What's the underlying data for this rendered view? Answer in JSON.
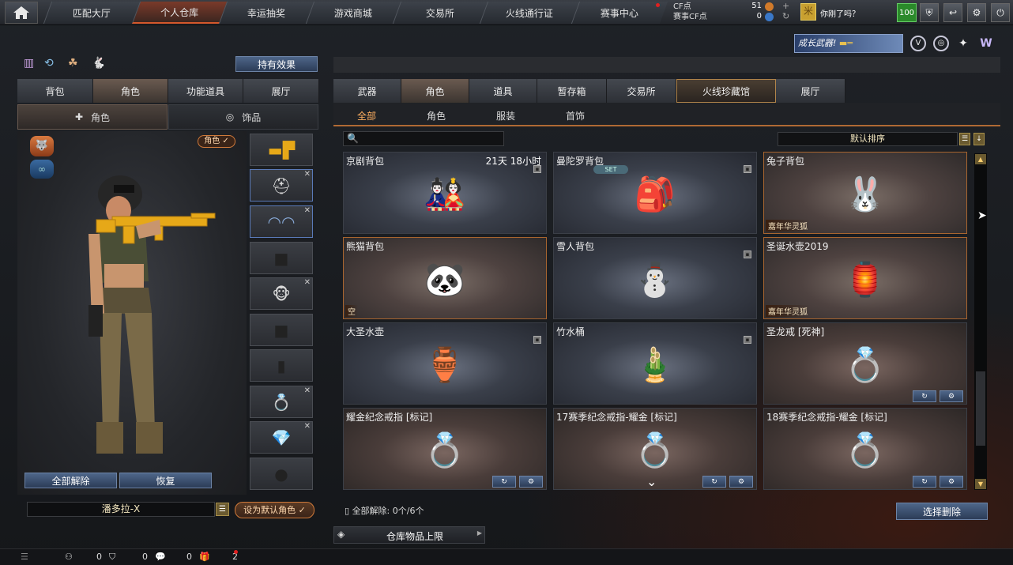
{
  "nav": {
    "tabs": [
      "匹配大厅",
      "个人仓库",
      "幸运抽奖",
      "游戏商城",
      "交易所",
      "火线通行证",
      "赛事中心"
    ],
    "active_index": 1,
    "cf_label": "CF点",
    "match_cf_label": "赛事CF点",
    "cf_value": "51",
    "match_cf_value": "0",
    "guess_text": "你刚了吗？",
    "level_badge": "100"
  },
  "banner": {
    "text": "成长武器!"
  },
  "left": {
    "effect_button": "持有效果",
    "tabs": [
      "背包",
      "角色",
      "功能道具",
      "展厅"
    ],
    "active_tab": 1,
    "subtabs": [
      "角色",
      "饰品"
    ],
    "role_badge": "角色 ✓",
    "unequip_all": "全部解除",
    "restore": "恢复",
    "character_name": "潘多拉-X",
    "set_default": "设为默认角色 ✓"
  },
  "right": {
    "tabs": [
      "武器",
      "角色",
      "道具",
      "暂存箱",
      "交易所",
      "火线珍藏馆",
      "展厅"
    ],
    "active_tab": 1,
    "filters": [
      "全部",
      "角色",
      "服装",
      "首饰"
    ],
    "active_filter": 0,
    "search_placeholder": "",
    "sort_label": "默认排序",
    "items": [
      {
        "name": "京剧背包",
        "time": "21天 18小时",
        "icon": "🎎",
        "lock": true,
        "style": "normal"
      },
      {
        "name": "曼陀罗背包",
        "set": "SET",
        "icon": "🎒",
        "lock": true,
        "style": "normal"
      },
      {
        "name": "兔子背包",
        "tag": "嘉年华灵狐",
        "icon": "🐰",
        "lock": false,
        "style": "gold"
      },
      {
        "name": "熊猫背包",
        "tag": "空",
        "icon": "🐼",
        "lock": false,
        "style": "gold"
      },
      {
        "name": "雪人背包",
        "icon": "⛄",
        "lock": true,
        "style": "normal"
      },
      {
        "name": "圣诞水壶2019",
        "tag": "嘉年华灵狐",
        "icon": "🏮",
        "lock": false,
        "style": "gold"
      },
      {
        "name": "大圣水壶",
        "icon": "🏺",
        "lock": true,
        "style": "normal"
      },
      {
        "name": "竹水桶",
        "icon": "🎍",
        "lock": true,
        "style": "normal"
      },
      {
        "name": "圣龙戒 [死神]",
        "icon": "💍",
        "lock": false,
        "style": "ringc",
        "buttons": true
      },
      {
        "name": "耀金纪念戒指 [标记]",
        "icon": "💍",
        "lock": false,
        "style": "ringc",
        "buttons": true
      },
      {
        "name": "17赛季纪念戒指-耀金 [标记]",
        "icon": "💍",
        "lock": false,
        "style": "ringc",
        "buttons": true
      },
      {
        "name": "18赛季纪念戒指-耀金 [标记]",
        "icon": "💍",
        "lock": false,
        "style": "ringc",
        "buttons": true
      }
    ],
    "unequip_status": "全部解除: 0个/6个",
    "select_delete": "选择删除",
    "storage_limit": "仓库物品上限"
  },
  "status": {
    "v1": "0",
    "v2": "0",
    "v3": "0",
    "v4": "2"
  }
}
